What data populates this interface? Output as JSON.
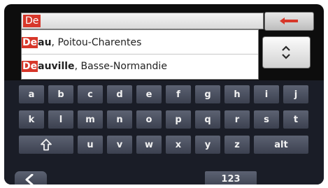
{
  "search": {
    "typed_text": "De"
  },
  "results": [
    {
      "match": "De",
      "rest": "au",
      "region": ", Poitou-Charentes"
    },
    {
      "match": "De",
      "rest": "auville",
      "region": ", Basse-Normandie"
    }
  ],
  "keyboard": {
    "row1": [
      "a",
      "b",
      "c",
      "d",
      "e",
      "f",
      "g",
      "h",
      "i",
      "j"
    ],
    "row2": [
      "k",
      "l",
      "m",
      "n",
      "o",
      "p",
      "q",
      "r",
      "s",
      "t"
    ],
    "row3_letters": [
      "u",
      "v",
      "w",
      "x",
      "y",
      "z"
    ],
    "alt_label": "alt",
    "numeric_label": "123"
  },
  "icons": {
    "backspace": "arrow-left-icon",
    "toggle": "up-down-chevron-icon",
    "shift": "shift-up-arrow-icon",
    "back": "chevron-left-icon"
  },
  "colors": {
    "highlight": "#d7372a",
    "key_bg": "#4c5262"
  }
}
